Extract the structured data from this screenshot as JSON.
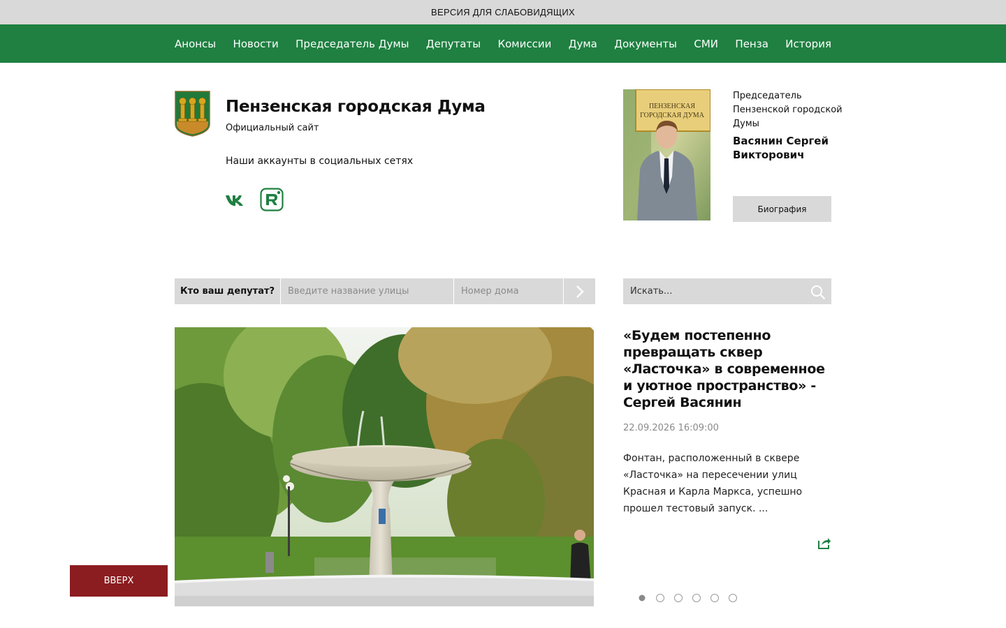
{
  "accessibility": {
    "label": "ВЕРСИЯ ДЛЯ СЛАБОВИДЯЩИХ"
  },
  "nav": {
    "items": [
      {
        "label": "Анонсы"
      },
      {
        "label": "Новости"
      },
      {
        "label": "Председатель Думы"
      },
      {
        "label": "Депутаты"
      },
      {
        "label": "Комиссии"
      },
      {
        "label": "Дума"
      },
      {
        "label": "Документы"
      },
      {
        "label": "СМИ"
      },
      {
        "label": "Пенза"
      },
      {
        "label": "История"
      }
    ]
  },
  "header": {
    "title": "Пензенская городская Дума",
    "subtitle": "Официальный сайт",
    "social_title": "Наши аккаунты в социальных сетях",
    "social_icons": [
      "vk-icon",
      "rutube-icon"
    ]
  },
  "chairman": {
    "role": "Председатель Пензенской городской Думы",
    "name": "Васянин Сергей Викторович",
    "bio_button": "Биография",
    "photo_sign": [
      "ПЕНЗЕНСКАЯ",
      "ГОРОДСКАЯ ДУМА"
    ]
  },
  "deputy_search": {
    "label": "Кто ваш депутат?",
    "street_placeholder": "Введите название улицы",
    "house_placeholder": "Номер дома",
    "submit_icon": "chevron-right-icon"
  },
  "search": {
    "placeholder": "Искать..."
  },
  "news": {
    "title": "«Будем постепенно превращать сквер «Ласточка» в современное и уютное пространство» - Сергей Васянин",
    "date": "22.09.2026 16:09:00",
    "text": "Фонтан, расположенный в сквере «Ласточка» на пересечении улиц Красная и Карла Маркса, успешно прошел тестовый запуск. ...",
    "share_icon": "share-icon",
    "slides_count": 6,
    "active_slide": 1
  },
  "up_button": {
    "label": "ВВЕРХ"
  },
  "colors": {
    "nav_green": "#1f8041",
    "up_button_red": "#8b1c1f",
    "gray_panel": "#d9d9d9"
  }
}
